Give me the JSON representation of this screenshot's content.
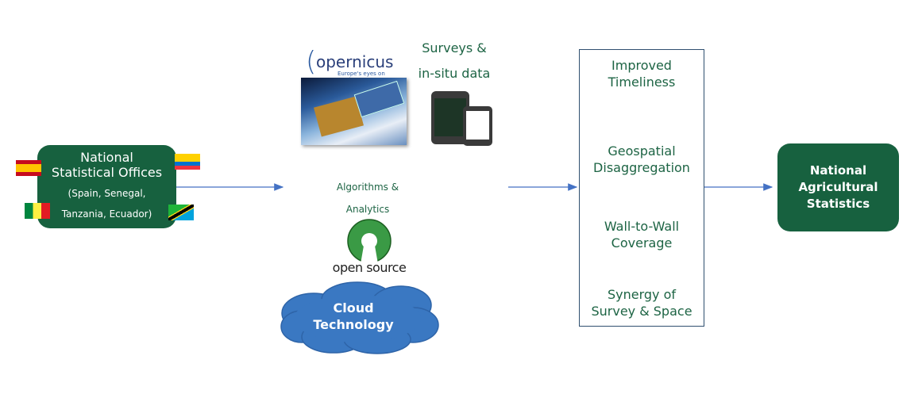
{
  "colors": {
    "box_green": "#17613f",
    "text_green": "#1d6444",
    "arrow": "#4472c4",
    "cloud": "#3a78c2",
    "border": "#2f4f6f"
  },
  "source": {
    "title_line1": "National",
    "title_line2": "Statistical Offices",
    "countries_line1": "(Spain, Senegal,",
    "countries_line2": "Tanzania, Ecuador)",
    "flags": [
      "Spain",
      "Ecuador",
      "Senegal",
      "Tanzania"
    ]
  },
  "inputs": {
    "copernicus_logo": "opernicus",
    "copernicus_tagline": "Europe's eyes on Earth",
    "surveys_line1": "Surveys &",
    "surveys_line2": "in-situ data",
    "algorithms_line1": "Algorithms &",
    "algorithms_line2": "Analytics",
    "opensource_logo": "open source",
    "cloud_line1": "Cloud",
    "cloud_line2": "Technology"
  },
  "benefits": [
    {
      "line1": "Improved",
      "line2": "Timeliness"
    },
    {
      "line1": "Geospatial",
      "line2": "Disaggregation"
    },
    {
      "line1": "Wall-to-Wall",
      "line2": "Coverage"
    },
    {
      "line1": "Synergy of",
      "line2": "Survey & Space"
    }
  ],
  "output": {
    "line1": "National",
    "line2": "Agricultural",
    "line3": "Statistics"
  }
}
